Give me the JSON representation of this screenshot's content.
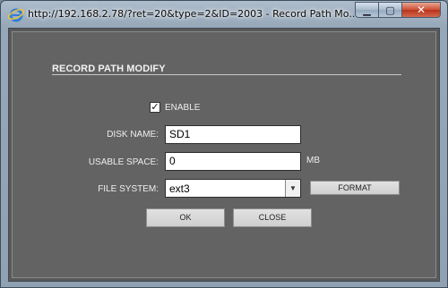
{
  "window": {
    "title": "http://192.168.2.78/?ret=20&type=2&ID=2003 - Record Path Mo...",
    "buttons": {
      "minimize_icon": "minimize-icon",
      "maximize_icon": "maximize-icon",
      "close_icon": "close-icon"
    }
  },
  "form": {
    "heading": "RECORD PATH MODIFY",
    "enable": {
      "label": "ENABLE",
      "checked": true
    },
    "disk_name": {
      "label": "DISK NAME:",
      "value": "SD1"
    },
    "usable_space": {
      "label": "USABLE SPACE:",
      "value": "0",
      "unit": "MB"
    },
    "file_system": {
      "label": "FILE SYSTEM:",
      "selected": "ext3"
    },
    "format_label": "FORMAT",
    "ok_label": "OK",
    "close_label": "CLOSE"
  },
  "colors": {
    "panel_bg": "#636363",
    "text": "#eeeeee",
    "title_text": "#0b0b0b"
  }
}
